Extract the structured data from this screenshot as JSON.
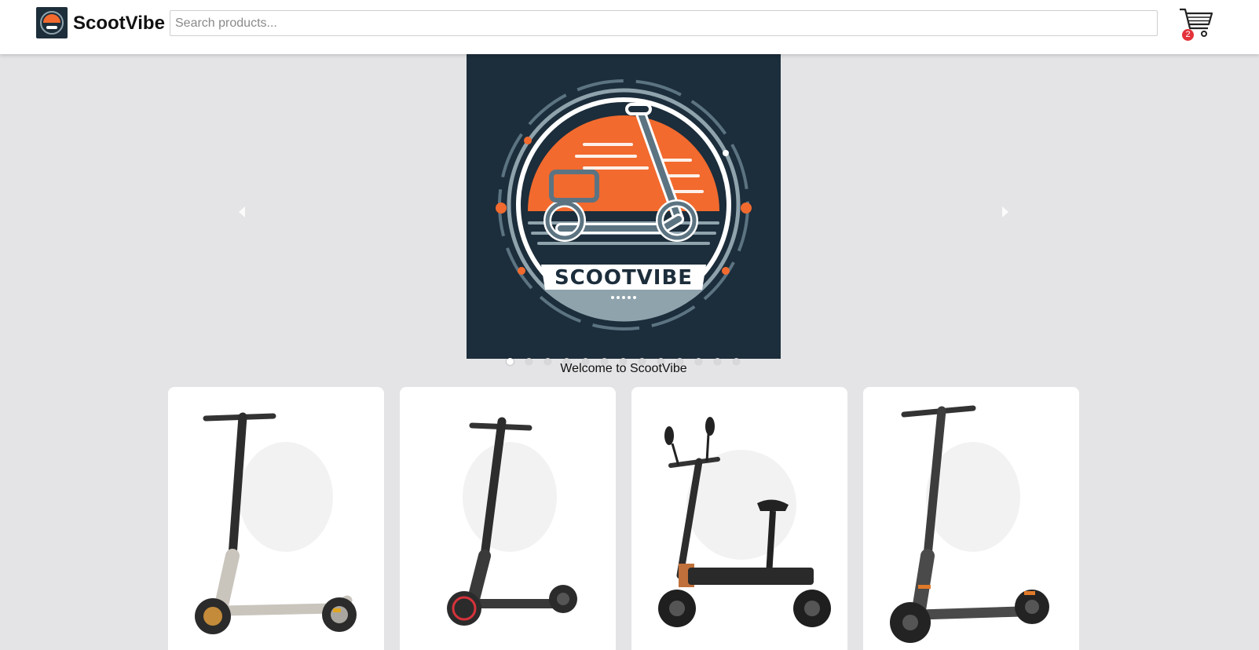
{
  "header": {
    "brand": "ScootVibe",
    "search_placeholder": "Search products...",
    "cart_count": "2"
  },
  "hero": {
    "logo_text": "SCOOTVIBE",
    "caption": "Welcome to ScootVibe",
    "slide_count": 13,
    "active_slide": 1
  },
  "products": [
    {
      "image": "grey-kick-scooter"
    },
    {
      "image": "black-kick-scooter-red-rim"
    },
    {
      "image": "seated-scooter-with-mirrors"
    },
    {
      "image": "dark-grey-kick-scooter"
    }
  ],
  "colors": {
    "brand_navy": "#1c2d3b",
    "brand_orange": "#f26a2e",
    "badge_red": "#e4323a"
  }
}
